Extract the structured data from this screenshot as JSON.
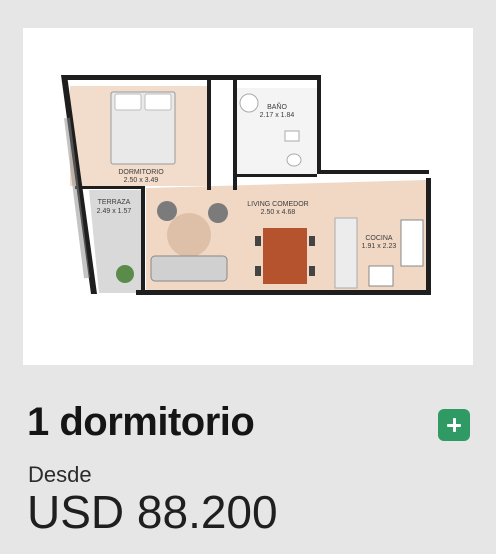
{
  "unit": {
    "title": "1 dormitorio",
    "price_prefix": "Desde",
    "price": "USD 88.200",
    "add_icon": "plus-icon",
    "accent_color": "#2f9a63"
  },
  "floor_plan": {
    "rooms": [
      {
        "name": "DORMITORIO",
        "size": "2.50 x 3.49"
      },
      {
        "name": "BAÑO",
        "size": "2.17 x 1.84"
      },
      {
        "name": "TERRAZA",
        "size": "2.49 x 1.57"
      },
      {
        "name": "LIVING COMEDOR",
        "size": "2.50 x 4.68"
      },
      {
        "name": "COCINA",
        "size": "1.91 x 2.23"
      }
    ]
  }
}
